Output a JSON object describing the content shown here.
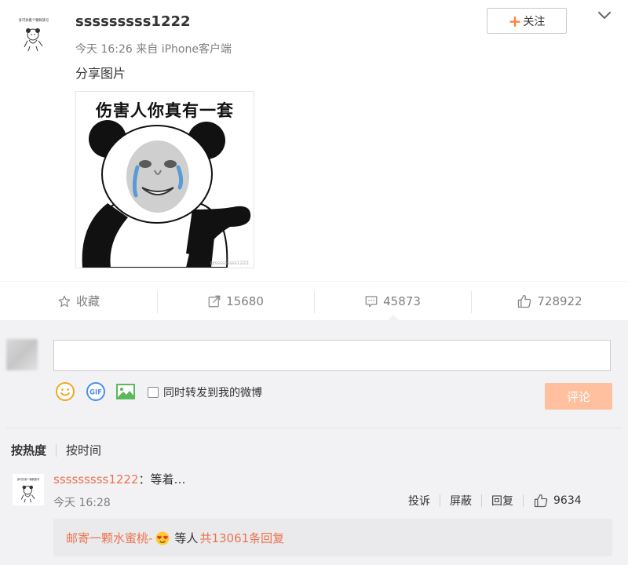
{
  "post": {
    "username": "sssssssss1222",
    "meta": "今天 16:26 来自 iPhone客户端",
    "text": "分享图片",
    "follow_plus": "+",
    "follow_label": "关注",
    "avatar_caption": "身可抗着个朝鲜族号",
    "meme_caption": "伤害人你真有一套",
    "meme_watermark": "@sssssssss1222"
  },
  "actions": [
    {
      "icon": "star-icon",
      "label": "收藏"
    },
    {
      "icon": "share-icon",
      "label": "15680"
    },
    {
      "icon": "comment-icon",
      "label": "45873"
    },
    {
      "icon": "thumbs-up-icon",
      "label": "728922"
    }
  ],
  "composer": {
    "input_value": "",
    "repost_label": "同时转发到我的微博",
    "submit_label": "评论",
    "tools": [
      "emoji-smiley-icon",
      "gif-icon",
      "image-icon"
    ]
  },
  "sort_tabs": [
    "按热度",
    "按时间"
  ],
  "comment": {
    "username": "sssssssss1222",
    "text": "：等着…",
    "time": "今天 16:28",
    "report": "投诉",
    "block": "屏蔽",
    "reply": "回复",
    "likes": "9634",
    "avatar_caption": "身可抗着个朝鲜族号"
  },
  "reply_summary": {
    "user": "邮寄一颗水蜜桃-",
    "emoji": "heart-eyes-emoji",
    "middle": "等人",
    "link": "共13061条回复"
  },
  "colors": {
    "accent": "#eb7350",
    "follow_plus": "#ff8140",
    "submit_bg": "#ffc09f",
    "comment_bg": "#f2f2f5"
  }
}
